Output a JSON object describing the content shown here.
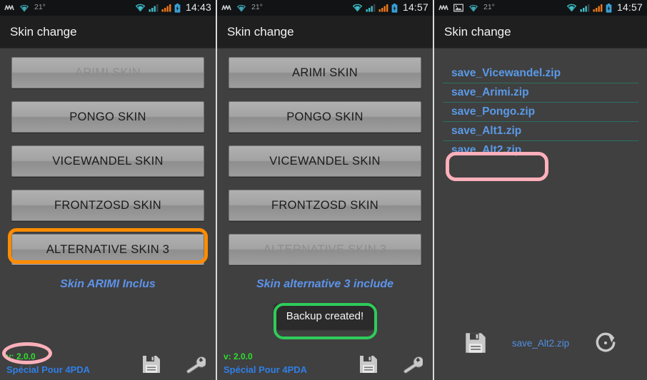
{
  "panels": [
    {
      "id": "panel-1",
      "statusbar": {
        "temp": "21°",
        "time": "14:43",
        "icons": [
          "mm-icon",
          "wifi-icon",
          "signal-teal-icon",
          "signal-orange-icon",
          "battery-charging-icon"
        ],
        "has_image_icon": false
      },
      "title": "Skin change",
      "buttons": [
        {
          "label": "ARIMI SKIN",
          "disabled": true
        },
        {
          "label": "PONGO SKIN",
          "disabled": false
        },
        {
          "label": "VICEWANDEL SKIN",
          "disabled": false
        },
        {
          "label": "FRONTZOSD SKIN",
          "disabled": false
        },
        {
          "label": "ALTERNATIVE SKIN 3",
          "disabled": false
        }
      ],
      "subtitle": "Skin ARIMI Inclus",
      "version": "v: 2.0.0",
      "special": "Spécial Pour 4PDA",
      "footer_icons": [
        "save-icon",
        "wrench-icon"
      ],
      "toast": null,
      "annotations": [
        {
          "name": "highlight-alternative-skin-3",
          "color": "#ff8c00",
          "shape": "rect"
        },
        {
          "name": "highlight-version",
          "color": "#ffb0bb",
          "shape": "ellipse"
        }
      ]
    },
    {
      "id": "panel-2",
      "statusbar": {
        "temp": "21°",
        "time": "14:57",
        "icons": [
          "mm-icon",
          "wifi-icon",
          "signal-teal-icon",
          "signal-orange-icon",
          "battery-charging-icon"
        ],
        "has_image_icon": false
      },
      "title": "Skin change",
      "buttons": [
        {
          "label": "ARIMI SKIN",
          "disabled": false
        },
        {
          "label": "PONGO SKIN",
          "disabled": false
        },
        {
          "label": "VICEWANDEL SKIN",
          "disabled": false
        },
        {
          "label": "FRONTZOSD SKIN",
          "disabled": false
        },
        {
          "label": "ALTERNATIVE SKIN 3",
          "disabled": true
        }
      ],
      "subtitle": "Skin alternative 3 include",
      "version": "v: 2.0.0",
      "special": "Spécial Pour 4PDA",
      "footer_icons": [
        "save-icon",
        "wrench-icon"
      ],
      "toast": "Backup created!",
      "annotations": [
        {
          "name": "highlight-toast",
          "color": "#2ecc5a",
          "shape": "rect"
        }
      ]
    },
    {
      "id": "panel-3",
      "statusbar": {
        "temp": "21°",
        "time": "14:57",
        "icons": [
          "mm-icon",
          "image-icon",
          "wifi-icon",
          "signal-teal-icon",
          "signal-orange-icon",
          "battery-charging-icon"
        ],
        "has_image_icon": true
      },
      "title": "Skin change",
      "files": [
        "save_Vicewandel.zip",
        "save_Arimi.zip",
        "save_Pongo.zip",
        "save_Alt1.zip",
        "save_Alt2.zip"
      ],
      "selected_file": "save_Alt2.zip",
      "bottom_icons": [
        "save-icon",
        "restore-icon"
      ],
      "annotations": [
        {
          "name": "highlight-save-alt2",
          "color": "#ffb0bb",
          "shape": "rect"
        }
      ]
    }
  ],
  "colors": {
    "app_background": "#404040",
    "title_background": "#1f1f1f",
    "status_background": "#111315",
    "accent_blue": "#5a9ae8",
    "version_green": "#2ce02c",
    "separator_teal": "#2c6f61",
    "anno_orange": "#ff8c00",
    "anno_green": "#2ecc5a",
    "anno_pink": "#ffb0bb"
  }
}
